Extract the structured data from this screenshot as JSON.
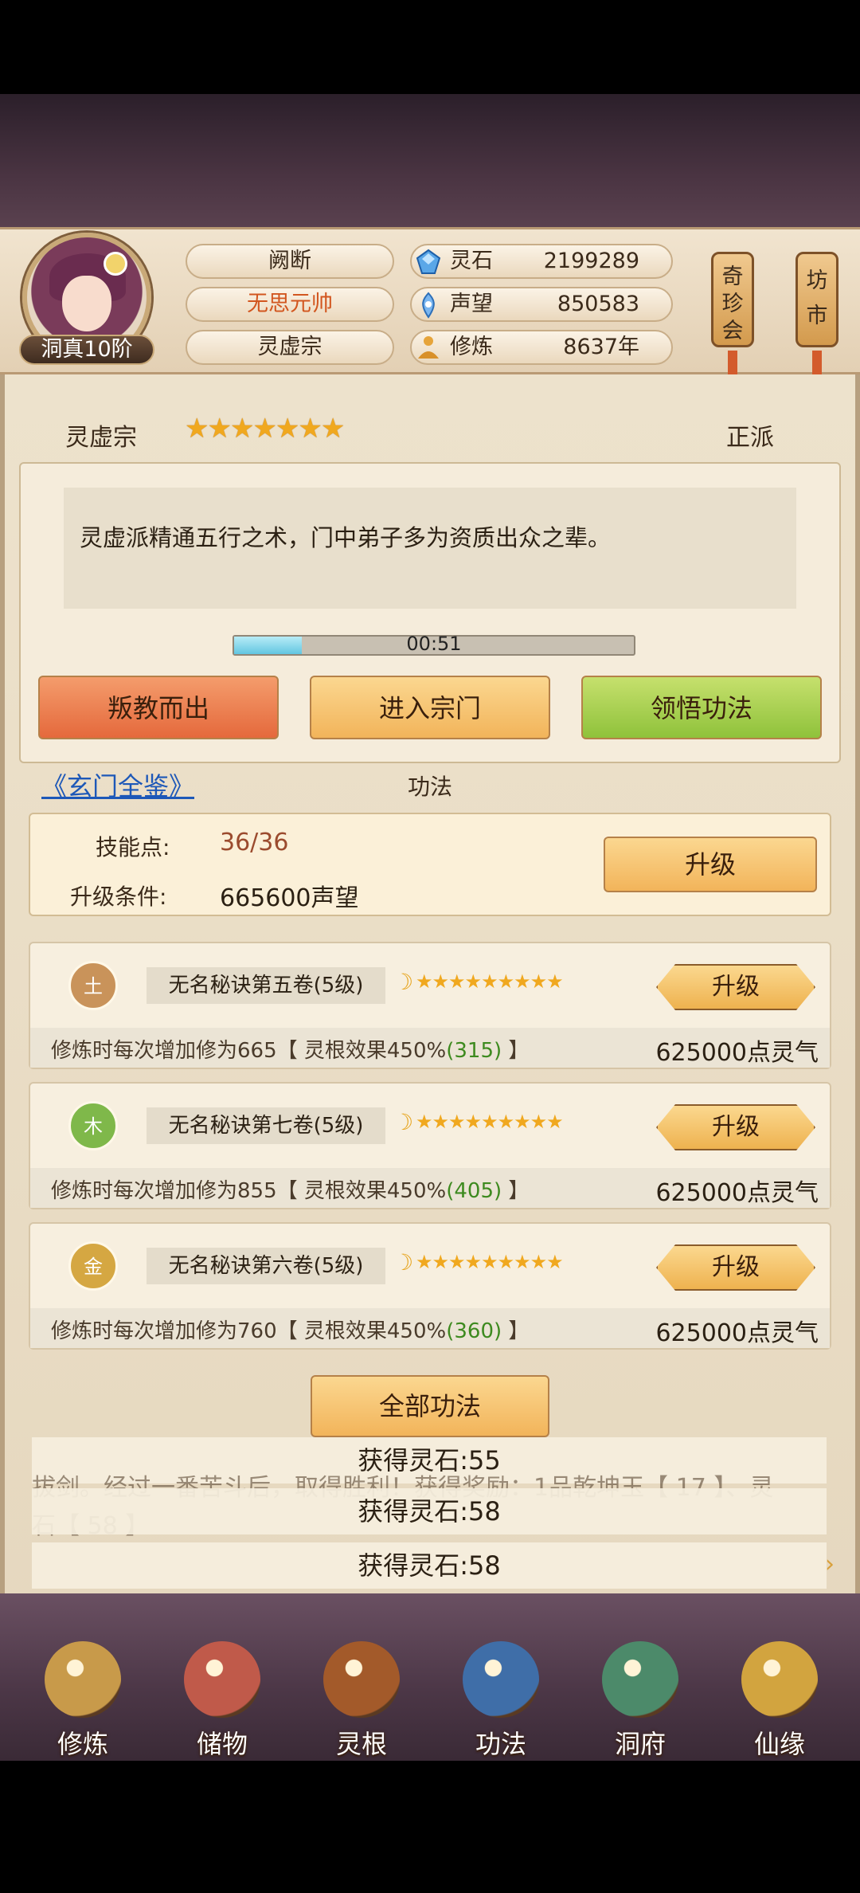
{
  "header": {
    "avatar_rank": "洞真10阶",
    "name": "阙断",
    "title": "无思元帅",
    "sect": "灵虚宗",
    "resources": [
      {
        "label": "灵石",
        "value": "2199289",
        "icon": "spirit-stone-icon"
      },
      {
        "label": "声望",
        "value": "850583",
        "icon": "reputation-icon"
      },
      {
        "label": "修炼",
        "value": "8637年",
        "icon": "meditation-icon"
      }
    ],
    "side_buttons": [
      "奇珍会",
      "坊市"
    ]
  },
  "sect": {
    "name": "灵虚宗",
    "stars": 7,
    "alignment": "正派",
    "description": "灵虚派精通五行之术，门中弟子多为资质出众之辈。",
    "timer": "00:51",
    "timer_progress": 0.17,
    "buttons": {
      "leave": "叛教而出",
      "enter": "进入宗门",
      "comprehend": "领悟功法"
    }
  },
  "techniques": {
    "link": "《玄门全鉴》",
    "section_title": "功法",
    "skill_points_label": "技能点:",
    "skill_points_value": "36/36",
    "upgrade_cond_label": "升级条件:",
    "upgrade_cond_value": "665600声望",
    "upgrade_label": "升级",
    "rows": [
      {
        "element": "土",
        "color": "#c9935a",
        "name": "无名秘诀第五卷(5级)",
        "stars": 9,
        "desc_prefix": "修炼时每次增加修为665【 灵根效果450%",
        "bonus": "(315)",
        "desc_suffix": " 】",
        "cost": "625000点灵气",
        "button": "升级"
      },
      {
        "element": "木",
        "color": "#7fb84a",
        "name": "无名秘诀第七卷(5级)",
        "stars": 9,
        "desc_prefix": "修炼时每次增加修为855【 灵根效果450%",
        "bonus": "(405)",
        "desc_suffix": " 】",
        "cost": "625000点灵气",
        "button": "升级"
      },
      {
        "element": "金",
        "color": "#d5a742",
        "name": "无名秘诀第六卷(5级)",
        "stars": 9,
        "desc_prefix": "修炼时每次增加修为760【 灵根效果450%",
        "bonus": "(360)",
        "desc_suffix": " 】",
        "cost": "625000点灵气",
        "button": "升级"
      }
    ],
    "all_button": "全部功法"
  },
  "log": {
    "text_line1": "拔剑。经过一番苦斗后，取得胜利！获得奖励：1品乾坤玉【 17 】、灵",
    "text_line2": "石【 58 】",
    "toasts": [
      "获得灵石:55",
      "获得灵石:58",
      "获得灵石:58"
    ]
  },
  "nav": [
    {
      "label": "修炼",
      "icon": "cultivate-icon",
      "color": "#c89a4a"
    },
    {
      "label": "储物",
      "icon": "storage-bag-icon",
      "color": "#c05a4a"
    },
    {
      "label": "灵根",
      "icon": "spirit-root-icon",
      "color": "#a35a2a"
    },
    {
      "label": "功法",
      "icon": "technique-book-icon",
      "color": "#3f6ea8"
    },
    {
      "label": "洞府",
      "icon": "cave-mansion-icon",
      "color": "#4c8a6a"
    },
    {
      "label": "仙缘",
      "icon": "immortal-fate-icon",
      "color": "#d2a43f"
    }
  ]
}
